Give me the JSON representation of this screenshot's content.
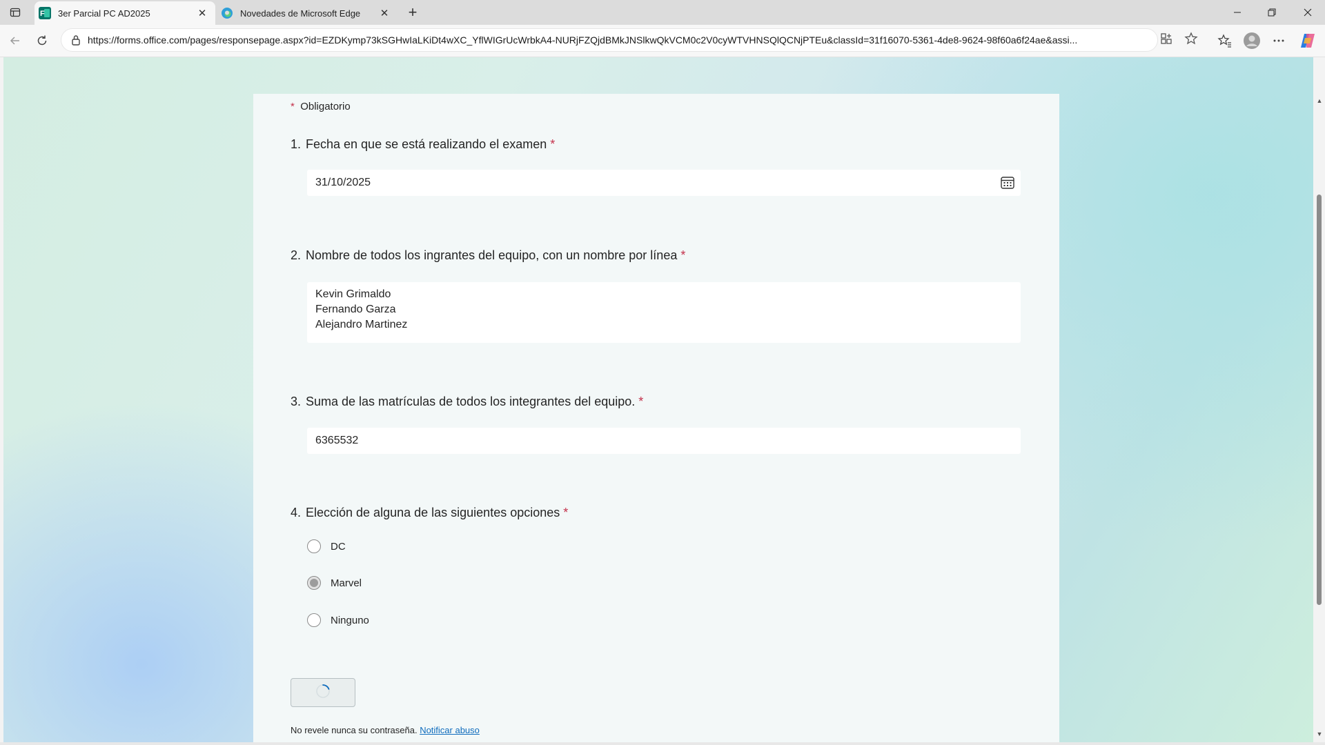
{
  "browser": {
    "tabs": [
      {
        "title": "3er Parcial PC AD2025",
        "active": true,
        "icon": "forms-icon"
      },
      {
        "title": "Novedades de Microsoft Edge",
        "active": false,
        "icon": "edge-icon"
      }
    ],
    "url": "https://forms.office.com/pages/responsepage.aspx?id=EZDKymp73kSGHwIaLKiDt4wXC_YflWIGrUcWrbkA4-NURjFZQjdBMkJNSlkwQkVCM0c2V0cyWTVHNSQlQCNjPTEu&classId=31f16070-5361-4de8-9624-98f60a6f24ae&assi..."
  },
  "form": {
    "required_note": "Obligatorio",
    "required_mark": "*",
    "questions": [
      {
        "num": "1.",
        "title": "Fecha en que se está realizando el examen",
        "value": "31/10/2025"
      },
      {
        "num": "2.",
        "title": "Nombre de todos los ingrantes del equipo, con un nombre por línea",
        "lines": [
          "Kevin Grimaldo",
          "Fernando Garza",
          "Alejandro Martinez"
        ]
      },
      {
        "num": "3.",
        "title": "Suma de las matrículas de todos los integrantes del equipo.",
        "value": "6365532"
      },
      {
        "num": "4.",
        "title": "Elección de alguna de las siguientes opciones",
        "options": [
          {
            "label": "DC",
            "selected": false
          },
          {
            "label": "Marvel",
            "selected": true
          },
          {
            "label": "Ninguno",
            "selected": false
          }
        ]
      }
    ],
    "footer_text": "No revele nunca su contraseña.",
    "footer_link": "Notificar abuso"
  },
  "colors": {
    "required": "#c4314b",
    "link": "#0f6cbd",
    "accent": "#0f6cbd"
  }
}
